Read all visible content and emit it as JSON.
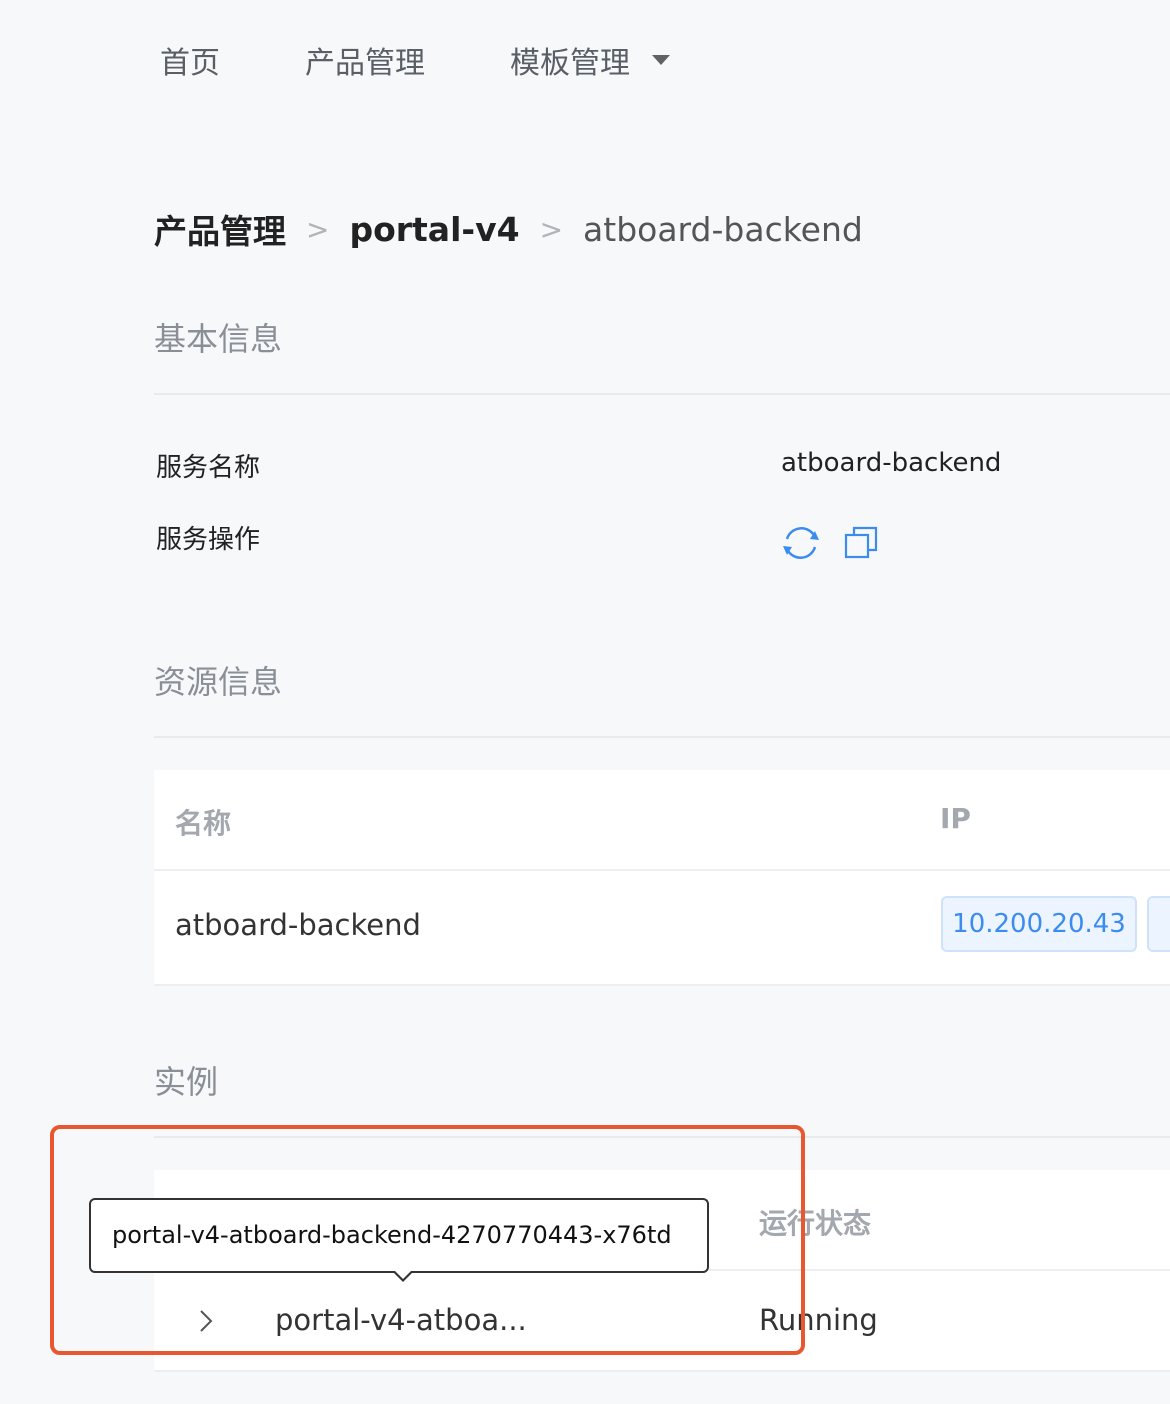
{
  "nav": {
    "home": "首页",
    "product": "产品管理",
    "template": "模板管理"
  },
  "breadcrumb": {
    "level1": "产品管理",
    "level2": "portal-v4",
    "current": "atboard-backend",
    "separator": ">"
  },
  "basic_info": {
    "title": "基本信息",
    "service_name_label": "服务名称",
    "service_name_value": "atboard-backend",
    "service_ops_label": "服务操作",
    "ops_icons": [
      "refresh-icon",
      "copy-icon"
    ]
  },
  "resource_info": {
    "title": "资源信息",
    "columns": [
      "名称",
      "IP"
    ],
    "rows": [
      {
        "name": "atboard-backend",
        "ip": "10.200.20.43"
      }
    ]
  },
  "instances": {
    "title": "实例",
    "columns": {
      "status": "运行状态"
    },
    "rows": [
      {
        "name": "portal-v4-atboa...",
        "status": "Running"
      }
    ],
    "tooltip": "portal-v4-atboard-backend-4270770443-x76td"
  },
  "colors": {
    "accent": "#3c8cf0",
    "highlight": "#e8572f",
    "page_bg": "#f7f8fa"
  }
}
